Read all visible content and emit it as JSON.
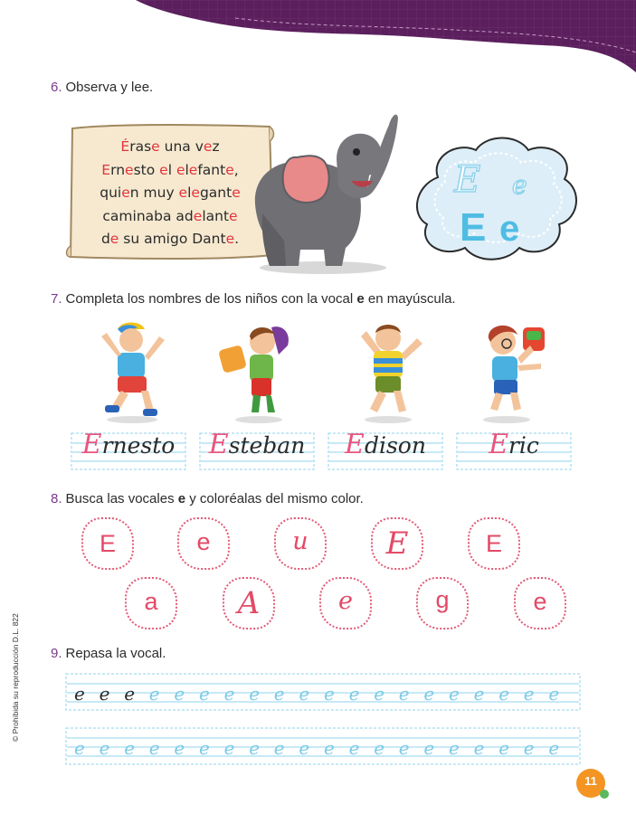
{
  "colors": {
    "purple": "#5a1f5c",
    "accent_red": "#e4343f",
    "pink": "#e8557e",
    "light_blue": "#8fd3ec",
    "orange": "#f39423"
  },
  "q6": {
    "number": "6.",
    "text": "Observa y lee."
  },
  "poem": {
    "line1": [
      {
        "t": "É",
        "r": true
      },
      {
        "t": "ras",
        "r": false
      },
      {
        "t": "e",
        "r": true
      },
      {
        "t": " una v",
        "r": false
      },
      {
        "t": "e",
        "r": true
      },
      {
        "t": "z",
        "r": false
      }
    ],
    "line2": [
      {
        "t": "E",
        "r": true
      },
      {
        "t": "rn",
        "r": false
      },
      {
        "t": "e",
        "r": true
      },
      {
        "t": "sto ",
        "r": false
      },
      {
        "t": "e",
        "r": true
      },
      {
        "t": "l ",
        "r": false
      },
      {
        "t": "e",
        "r": true
      },
      {
        "t": "l",
        "r": false
      },
      {
        "t": "e",
        "r": true
      },
      {
        "t": "fant",
        "r": false
      },
      {
        "t": "e",
        "r": true
      },
      {
        "t": ",",
        "r": false
      }
    ],
    "line3": [
      {
        "t": "qui",
        "r": false
      },
      {
        "t": "e",
        "r": true
      },
      {
        "t": "n muy ",
        "r": false
      },
      {
        "t": "e",
        "r": true
      },
      {
        "t": "l",
        "r": false
      },
      {
        "t": "e",
        "r": true
      },
      {
        "t": "gant",
        "r": false
      },
      {
        "t": "e",
        "r": true
      }
    ],
    "line4": [
      {
        "t": "caminaba ad",
        "r": false
      },
      {
        "t": "e",
        "r": true
      },
      {
        "t": "lant",
        "r": false
      },
      {
        "t": "e",
        "r": true
      }
    ],
    "line5": [
      {
        "t": "d",
        "r": false
      },
      {
        "t": "e",
        "r": true
      },
      {
        "t": " su amigo Dant",
        "r": false
      },
      {
        "t": "e",
        "r": true
      },
      {
        "t": ".",
        "r": false
      }
    ]
  },
  "cloud_letters": {
    "script_upper": "E",
    "script_lower": "e",
    "print_upper": "E",
    "print_lower": "e"
  },
  "q7": {
    "number": "7.",
    "text_before": "Completa los nombres de los niños con la vocal ",
    "text_bold": "e",
    "text_after": " en mayúscula."
  },
  "names": [
    {
      "cap": "E",
      "rest": "rnesto"
    },
    {
      "cap": "E",
      "rest": "steban"
    },
    {
      "cap": "E",
      "rest": "dison"
    },
    {
      "cap": "E",
      "rest": "ric"
    }
  ],
  "q8": {
    "number": "8.",
    "text_before": "Busca las vocales ",
    "text_bold": "e",
    "text_after": " y coloréalas del mismo color."
  },
  "bubbles_row1": [
    "E",
    "e",
    "u",
    "E",
    "E"
  ],
  "bubbles_row2": [
    "a",
    "A",
    "e",
    "g",
    "e"
  ],
  "q9": {
    "number": "9.",
    "text": "Repasa la vocal."
  },
  "trace_row1": {
    "dark_count": 3,
    "light_count": 17,
    "letter": "e"
  },
  "trace_row2": {
    "dark_count": 0,
    "light_count": 20,
    "letter": "e"
  },
  "side_note": "© Prohibida su reproducción D.L. 822",
  "page_number": "11"
}
